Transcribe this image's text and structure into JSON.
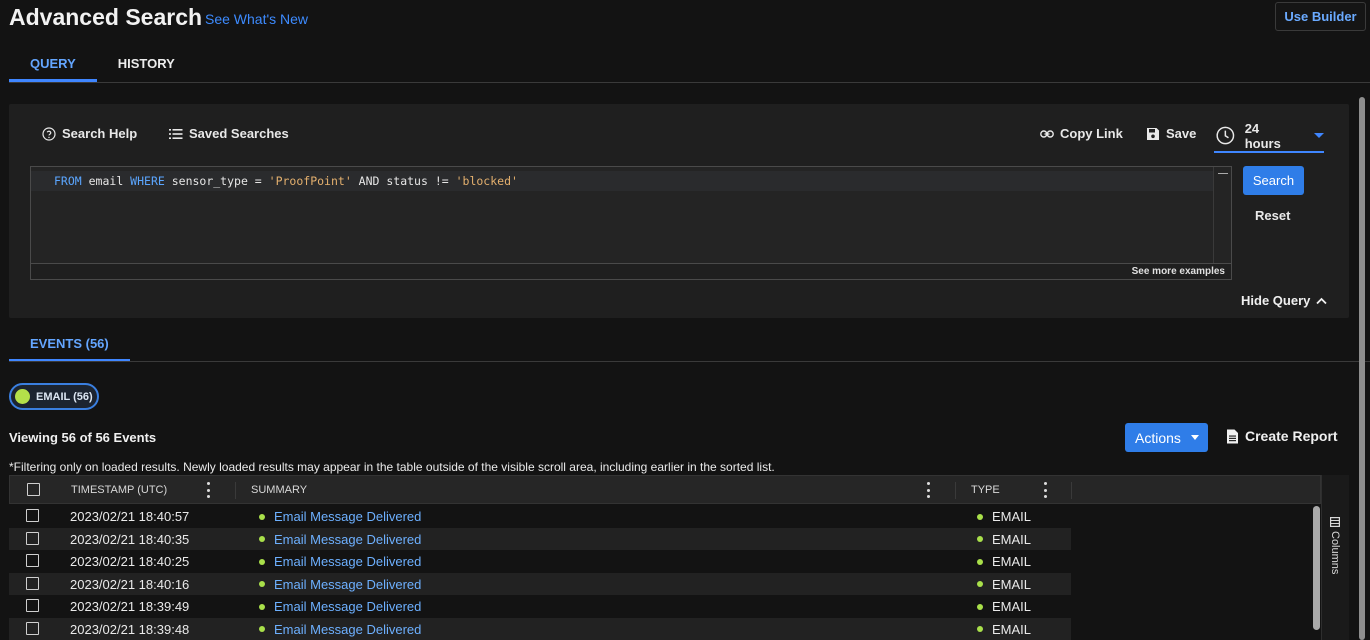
{
  "header": {
    "title": "Advanced Search",
    "whats_new": "See What's New",
    "use_builder": "Use Builder"
  },
  "tabs": [
    {
      "label": "QUERY",
      "active": true
    },
    {
      "label": "HISTORY",
      "active": false
    }
  ],
  "query_panel": {
    "search_help": "Search Help",
    "saved_searches": "Saved Searches",
    "copy_link": "Copy Link",
    "save": "Save",
    "time_range": "24 hours",
    "query_text": "FROM email WHERE sensor_type = 'ProofPoint' AND status != 'blocked'",
    "see_more": "See more examples",
    "search_button": "Search",
    "reset_button": "Reset",
    "hide_query": "Hide Query"
  },
  "events": {
    "tab_label": "EVENTS (56)",
    "chip_label": "EMAIL (56)",
    "viewing": "Viewing 56 of 56 Events",
    "actions_button": "Actions",
    "create_report": "Create Report",
    "filter_note": "*Filtering only on loaded results.  Newly loaded results may appear in the table outside of the visible scroll area, including earlier in the sorted list.",
    "columns_label": "Columns",
    "headers": {
      "timestamp": "TIMESTAMP (UTC)",
      "summary": "SUMMARY",
      "type": "TYPE"
    },
    "rows": [
      {
        "timestamp": "2023/02/21 18:40:57",
        "summary": "Email Message Delivered",
        "type": "EMAIL"
      },
      {
        "timestamp": "2023/02/21 18:40:35",
        "summary": "Email Message Delivered",
        "type": "EMAIL"
      },
      {
        "timestamp": "2023/02/21 18:40:25",
        "summary": "Email Message Delivered",
        "type": "EMAIL"
      },
      {
        "timestamp": "2023/02/21 18:40:16",
        "summary": "Email Message Delivered",
        "type": "EMAIL"
      },
      {
        "timestamp": "2023/02/21 18:39:49",
        "summary": "Email Message Delivered",
        "type": "EMAIL"
      },
      {
        "timestamp": "2023/02/21 18:39:48",
        "summary": "Email Message Delivered",
        "type": "EMAIL"
      }
    ]
  },
  "colors": {
    "accent": "#2f7de8",
    "link": "#6db0ff",
    "status_dot": "#a9e04a",
    "background": "#131313"
  }
}
